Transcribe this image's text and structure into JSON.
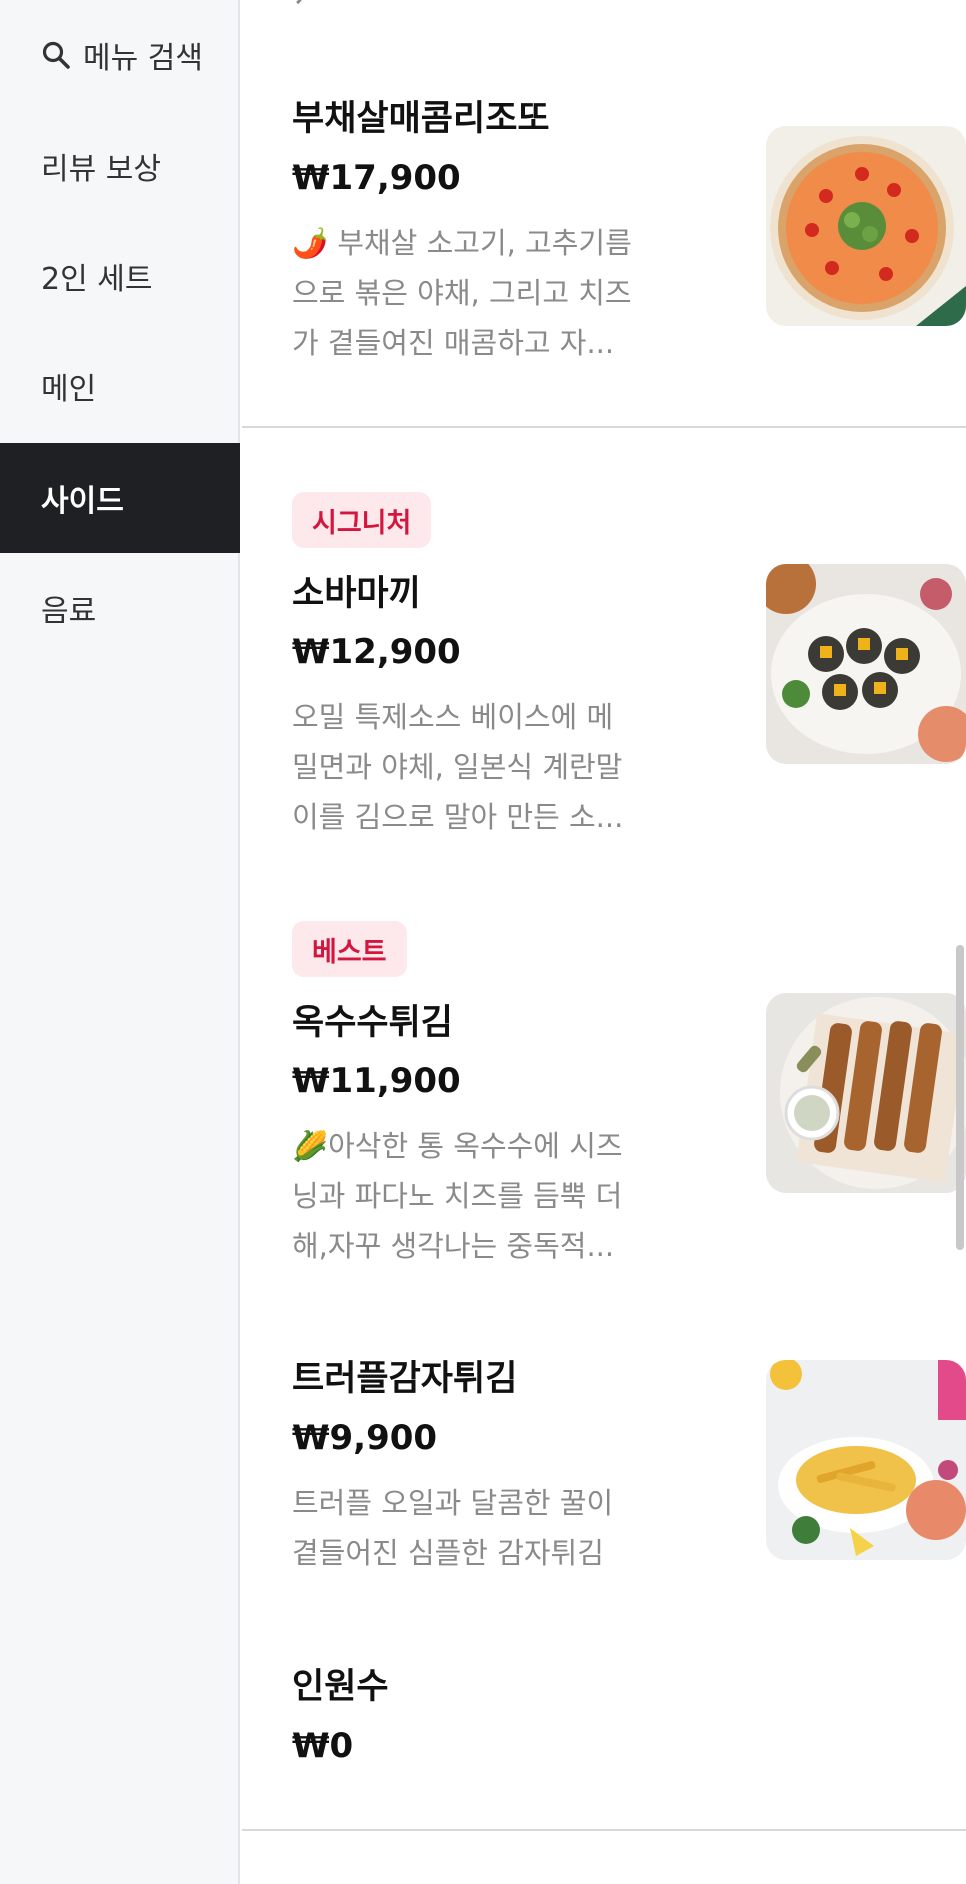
{
  "sidebar": {
    "search_label": "메뉴 검색",
    "items": [
      {
        "label": "리뷰 보상",
        "active": false
      },
      {
        "label": "2인 세트",
        "active": false
      },
      {
        "label": "메인",
        "active": false
      },
      {
        "label": "사이드",
        "active": true
      },
      {
        "label": "음료",
        "active": false
      }
    ]
  },
  "menu": {
    "items": [
      {
        "badge": "",
        "name": "부채살매콤리조또",
        "price": "₩17,900",
        "desc_lines": [
          "🌶️ 부채살 소고기, 고추기름",
          "으로 볶은 야채, 그리고 치즈",
          "가 곁들여진 매콤하고 자..."
        ],
        "image_icon": "risotto-photo"
      },
      {
        "badge": "시그니처",
        "name": "소바마끼",
        "price": "₩12,900",
        "desc_lines": [
          "오밀 특제소스 베이스에 메",
          "밀면과 야체, 일본식 계란말",
          "이를 김으로 말아 만든 소..."
        ],
        "image_icon": "soba-maki-photo"
      },
      {
        "badge": "베스트",
        "name": "옥수수튀김",
        "price": "₩11,900",
        "desc_lines": [
          "🌽아삭한 통 옥수수에 시즈",
          "닝과 파다노 치즈를 듬뿍 더",
          "해,자꾸 생각나는 중독적..."
        ],
        "image_icon": "corn-fries-photo"
      },
      {
        "badge": "",
        "name": "트러플감자튀김",
        "price": "₩9,900",
        "desc_lines": [
          "트러플 오일과 달콤한 꿀이",
          "곁들어진 심플한 감자튀김"
        ],
        "image_icon": "truffle-fries-photo"
      },
      {
        "badge": "",
        "name": "인원수",
        "price": "₩0",
        "desc_lines": [],
        "image_icon": ""
      }
    ]
  },
  "colors": {
    "active_bg": "#1f2023",
    "badge_bg": "#fde8ec",
    "badge_text": "#d4163f",
    "desc_text": "#8a8a8a"
  }
}
